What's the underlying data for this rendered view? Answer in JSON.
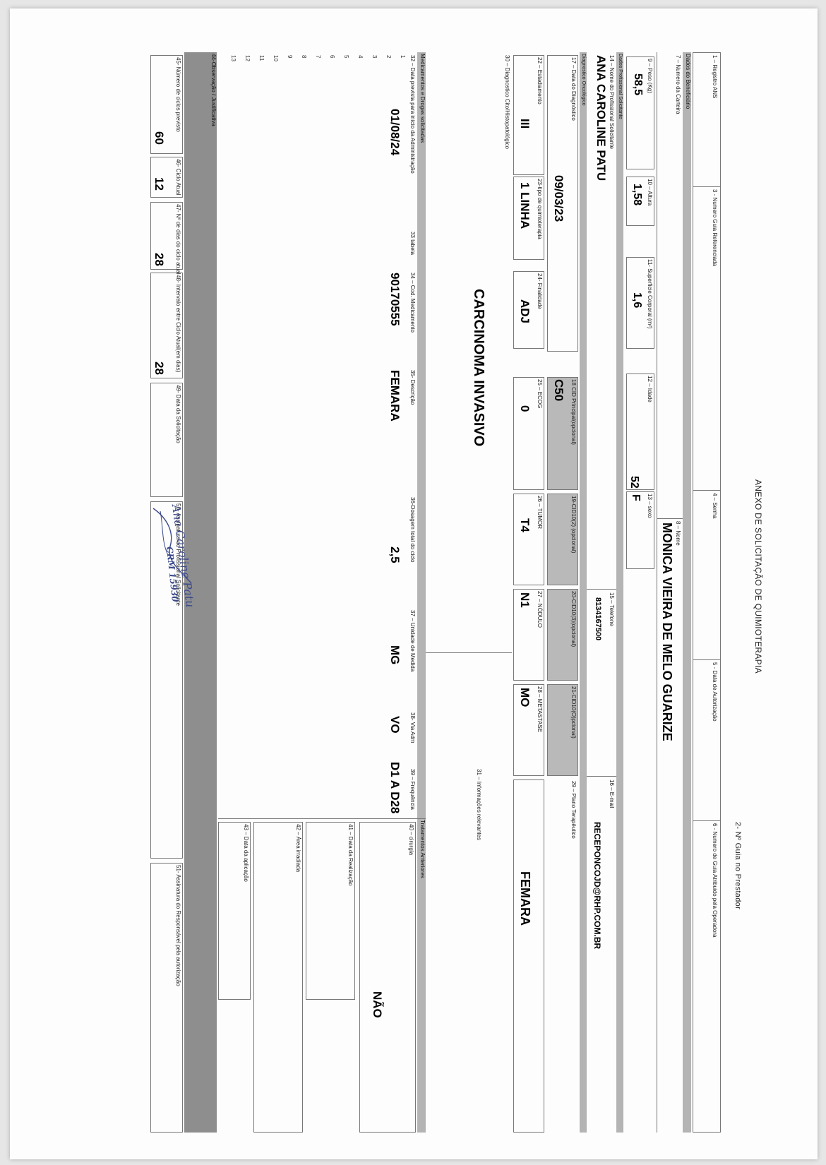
{
  "header": {
    "title": "ANEXO DE SOLICITAÇÃO DE QUIMIOTERAPIA",
    "guide_provider_label": "2- Nº Guia no Prestador"
  },
  "row_top": {
    "registro_ans_label": "1 – Registro ANS",
    "guia_referenciada_label": "3 - Numero Guia Referenciada",
    "senha_label": "4 – Senha",
    "data_autorizacao_label": "5 - Data de Autorização",
    "guia_operadora_label": "6 - Numero de Guia Atribuido pela Operadora"
  },
  "beneficiario": {
    "section_label": "Dados do Beneficiário",
    "carteira_label": "7 – Numero da Carteira",
    "nome_label": "8 – Nome",
    "nome": "MONICA VIEIRA DE MELO GUARIZE",
    "peso_label": "9 – Peso (Kg)",
    "peso": "58,5",
    "altura_label": "10 – Altura",
    "altura": "1,58",
    "superficie_label": "11- Superficie Corporal (m²)",
    "superficie": "1,6",
    "idade_label": "12 – Idade",
    "idade": "52",
    "sexo_label": "13 – sexo",
    "sexo": "F"
  },
  "profissional": {
    "section_label": "Dados Profissional Solicitante",
    "nome_label": "14 – Nome do Profissional Solicitante",
    "nome": "ANA CAROLINE PATU",
    "telefone_label": "15 – Telefone",
    "telefone": "8134167500",
    "email_label": "16 – E-mail",
    "email": "RECEPONCOJD@RHP.COM.BR"
  },
  "diagnostico": {
    "section_label": "Diagnostico Oncológico",
    "data_label": "17 – Data do Diagnóstico",
    "data": "09/03/23",
    "cid_principal_label": "18 CID Principal(opcional)",
    "cid_principal": "C50",
    "cid2_label": "19-CID10(2) (opcional)",
    "cid3_label": "20-CID10(3)(opcional)",
    "cid4_label": "21-CID10(O)pcional)",
    "estadiamento_label": "22 – Estadiamento",
    "estadiamento": "III",
    "tipo_label": "23-tipo de quimioterapia",
    "tipo": "1 LINHA",
    "finalidade_label": "24- Finalidade",
    "finalidade": "ADJ",
    "ecog_label": "25 – ECOG",
    "ecog": "0",
    "tumor_label": "26 – TUMOR",
    "tumor": "T4",
    "nodulo_label": "27 – NÓDULO",
    "nodulo": "N1",
    "metastase_label": "28 – METASTASE",
    "metastase": "MO",
    "plano_label": "29 – Plano Terapêutico",
    "plano": "FEMARA",
    "cito_label": "30 – Diagnostico Cito/Histopatológico",
    "cito": "CARCINOMA INVASIVO",
    "info_label": "31 – Informações relevantes"
  },
  "medicamentos": {
    "section_label": "Medicamentos e Drogas solicitadas",
    "headers": {
      "data": "32 – Data prevista para início da Administração",
      "tabela": "33 tabela",
      "codigo": "34 – Cod. Medicamento",
      "descricao": "35- Descrição",
      "dosagem": "36-Dosagem total do ciclo",
      "unidade": "37 – Unidade de Medida",
      "via": "38- Via Adm",
      "frequencia": "39 – Frequência"
    },
    "row_numbers": [
      "1",
      "2",
      "3",
      "4",
      "5",
      "6",
      "7",
      "8",
      "9",
      "10",
      "11",
      "12",
      "13"
    ],
    "rows": [
      {
        "data": "01/08/24",
        "codigo": "90170555",
        "descricao": "FEMARA",
        "dosagem": "2,5",
        "unidade": "MG",
        "via": "VO",
        "frequencia": "D1 A D28"
      }
    ]
  },
  "tratamentos": {
    "section_label": "Tratamentos Anteriores",
    "cirurgia_label": "40 – cirurgia",
    "cirurgia": "NÃO",
    "data_realizacao_label": "41 – Data da Realização",
    "area_label": "42 – Área irradiada",
    "data_aplicacao_label": "43 – Data da aplicação"
  },
  "observacao": {
    "label": "44-Observação / Justificativa"
  },
  "ciclos": {
    "numero_label": "45- Número de ciclos previsto",
    "numero": "60",
    "atual_label": "46- Ciclo Atual",
    "atual": "12",
    "dias_label": "47- Nº de dias do ciclo atual",
    "dias": "28",
    "intervalo_label": "48- Intervalo entre Ciclo Atual(em dias)",
    "intervalo": "28",
    "data_solicitacao_label": "49- Data da Solicitação",
    "assinatura_label": "50- Assinatura do Profissional Solicitante",
    "assinatura_responsavel_label": "51- Assinatura do Responsável pela autorização",
    "signature_text": "Ana Caroline Patu",
    "signature_crm": "CRM 15930"
  },
  "colors": {
    "band": "#b4b4b4",
    "shaded_cell": "#b9b9b9",
    "dark_band": "#8e8e8e",
    "ink_signature": "#3b4a8c"
  }
}
